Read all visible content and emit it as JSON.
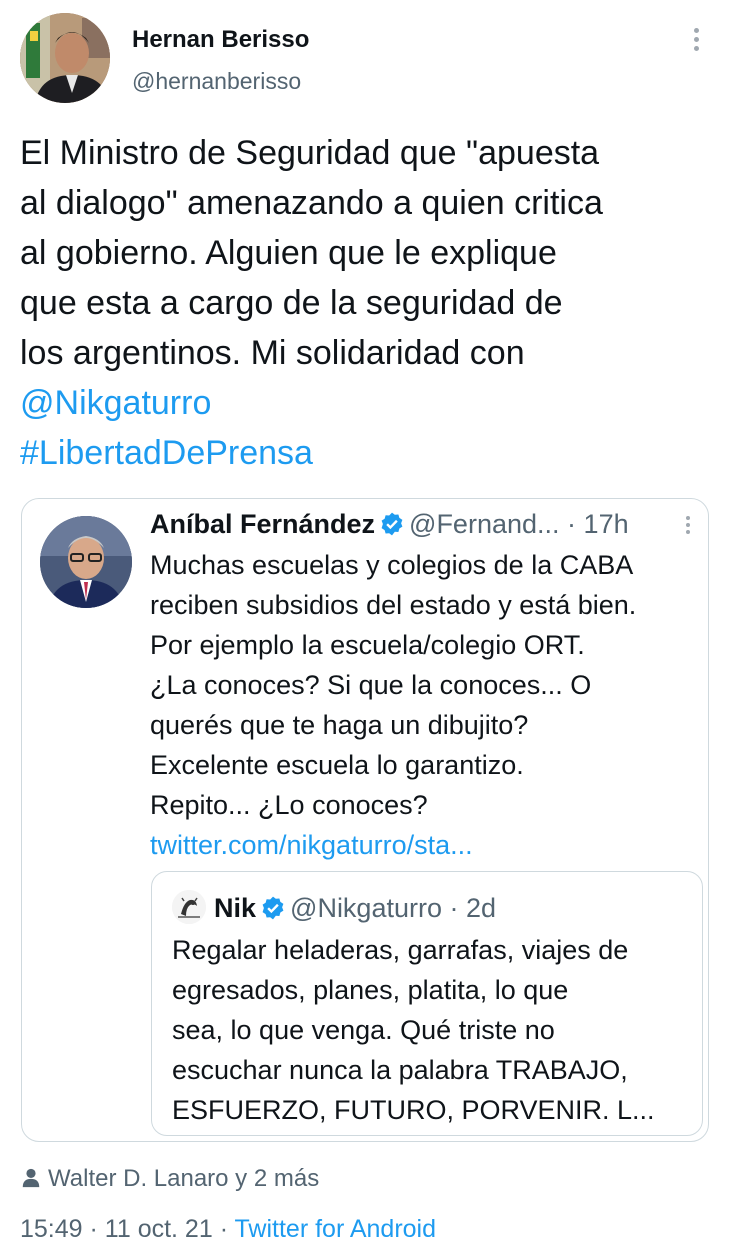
{
  "author": {
    "name": "Hernan Berisso",
    "handle": "@hernanberisso"
  },
  "tweet": {
    "lines": [
      "El Ministro de Seguridad que \"apuesta",
      "al dialogo\" amenazando a quien critica",
      "al gobierno. Alguien que le explique",
      "que esta a cargo de la seguridad de",
      "los argentinos. Mi solidaridad con"
    ],
    "mention": "@Nikgaturro",
    "hashtag": "#LibertadDePrensa"
  },
  "quoted": {
    "name": "Aníbal Fernández",
    "handle": "@Fernand...",
    "separator": "·",
    "time": "17h",
    "lines": [
      "Muchas escuelas y colegios de la CABA",
      "reciben subsidios del estado y está bien.",
      "Por ejemplo la escuela/colegio ORT.",
      "¿La conoces? Si que la conoces... O",
      "querés que te haga un dibujito?",
      "Excelente escuela lo garantizo.",
      "Repito... ¿Lo conoces?"
    ],
    "link": "twitter.com/nikgaturro/sta...",
    "nested": {
      "name": "Nik",
      "handle": "@Nikgaturro",
      "separator": "·",
      "time": "2d",
      "lines": [
        "Regalar heladeras, garrafas, viajes de",
        "egresados, planes, platita, lo que",
        "sea, lo que venga. Qué triste no",
        "escuchar nunca la palabra TRABAJO,",
        "ESFUERZO, FUTURO, PORVENIR. L..."
      ]
    }
  },
  "likes": {
    "text": "Walter D. Lanaro y 2 más",
    "icon": "person-icon"
  },
  "footer": {
    "time": "15:49",
    "sep1": "·",
    "date": "11 oct. 21",
    "sep2": "·",
    "source": "Twitter for Android"
  },
  "colors": {
    "link": "#1d9bf0",
    "secondary": "#536471",
    "border": "#cfd9de"
  }
}
